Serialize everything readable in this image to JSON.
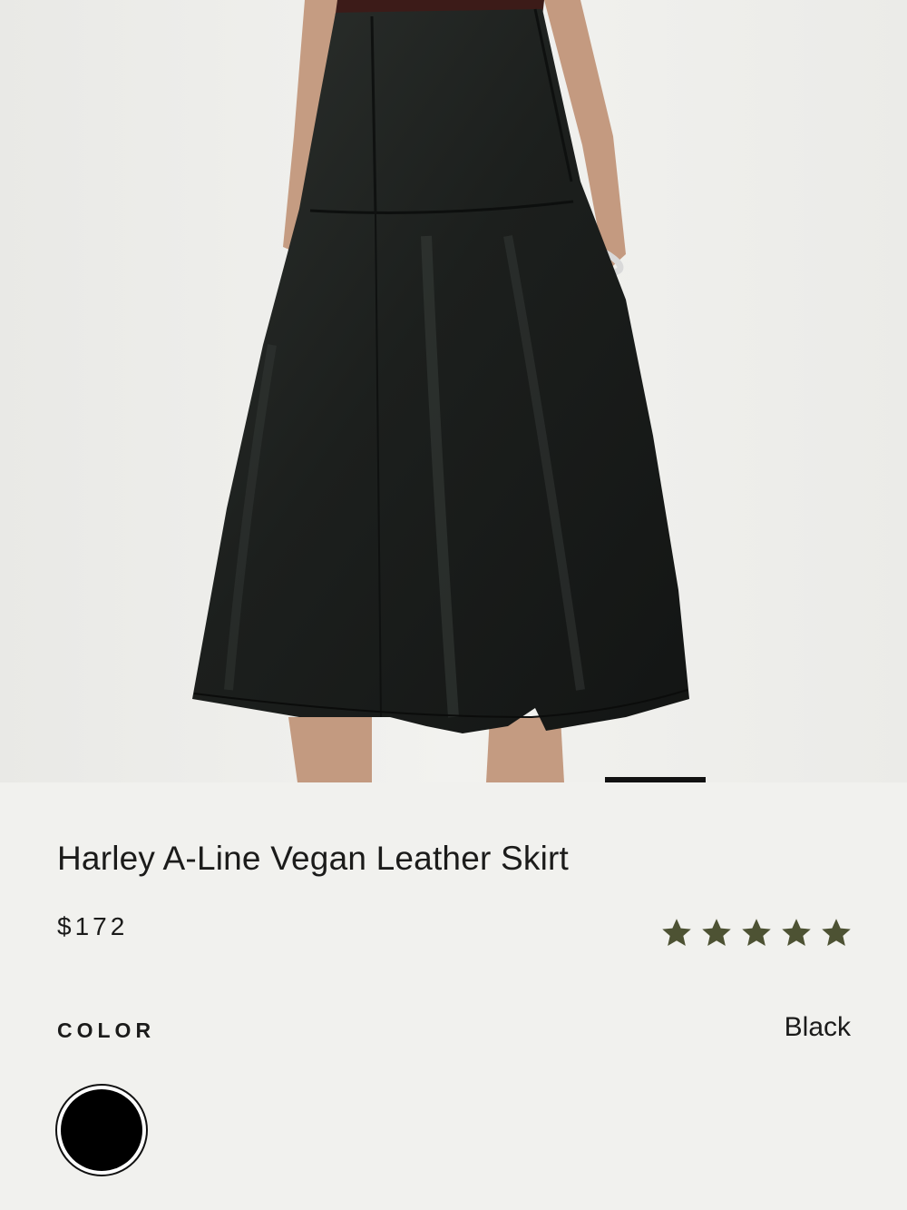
{
  "product": {
    "title": "Harley A-Line Vegan Leather Skirt",
    "price": "$172",
    "rating": 5,
    "rating_max": 5,
    "star_color": "#4d5233"
  },
  "gallery": {
    "image_count_progress": 0.72
  },
  "color": {
    "label": "COLOR",
    "selected_value": "Black",
    "swatch_color": "#000000"
  }
}
